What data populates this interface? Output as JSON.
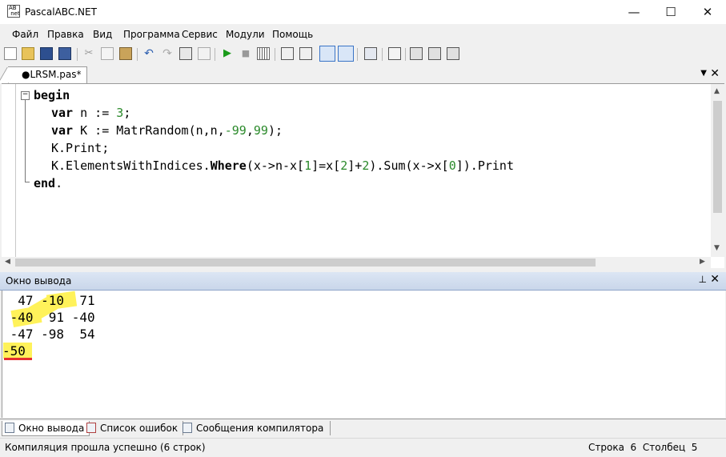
{
  "window": {
    "title": "PascalABC.NET",
    "minimize": "—",
    "maximize": "☐",
    "close": "✕"
  },
  "menu": [
    "Файл",
    "Правка",
    "Вид",
    "Программа",
    "Сервис",
    "Модули",
    "Помощь"
  ],
  "editor_tab": {
    "label": "●LRSM.pas*"
  },
  "code": {
    "line1_kw": "begin",
    "line2_kw": "var",
    "line2_a": " n := ",
    "line2_num": "3",
    "line2_b": ";",
    "line3_kw": "var",
    "line3_a": " K := MatrRandom(n,n,",
    "line3_n1": "-99",
    "line3_b": ",",
    "line3_n2": "99",
    "line3_c": ");",
    "line4": "K.Print;",
    "line5_a": "K.ElementsWithIndices.",
    "line5_kw": "Where",
    "line5_b": "(x->n-x[",
    "line5_n1": "1",
    "line5_c": "]=x[",
    "line5_n2": "2",
    "line5_d": "]+",
    "line5_n3": "2",
    "line5_e": ").Sum(x->x[",
    "line5_n4": "0",
    "line5_f": "]).Print",
    "line6_kw": "end",
    "line6_b": "."
  },
  "output_panel": {
    "title": "Окно вывода",
    "lines": [
      "  47 -10  71",
      " -40  91 -40",
      " -47 -98  54",
      "-50"
    ]
  },
  "bottom_tabs": [
    "Окно вывода",
    "Список ошибок",
    "Сообщения компилятора"
  ],
  "status": {
    "message": "Компиляция прошла успешно (6 строк)",
    "position": "Строка  6  Столбец  5"
  },
  "colors": {
    "number": "#2b8a2b",
    "highlight": "#fff25a",
    "underline": "#e53030",
    "panel_header": "#c9d6ea"
  }
}
